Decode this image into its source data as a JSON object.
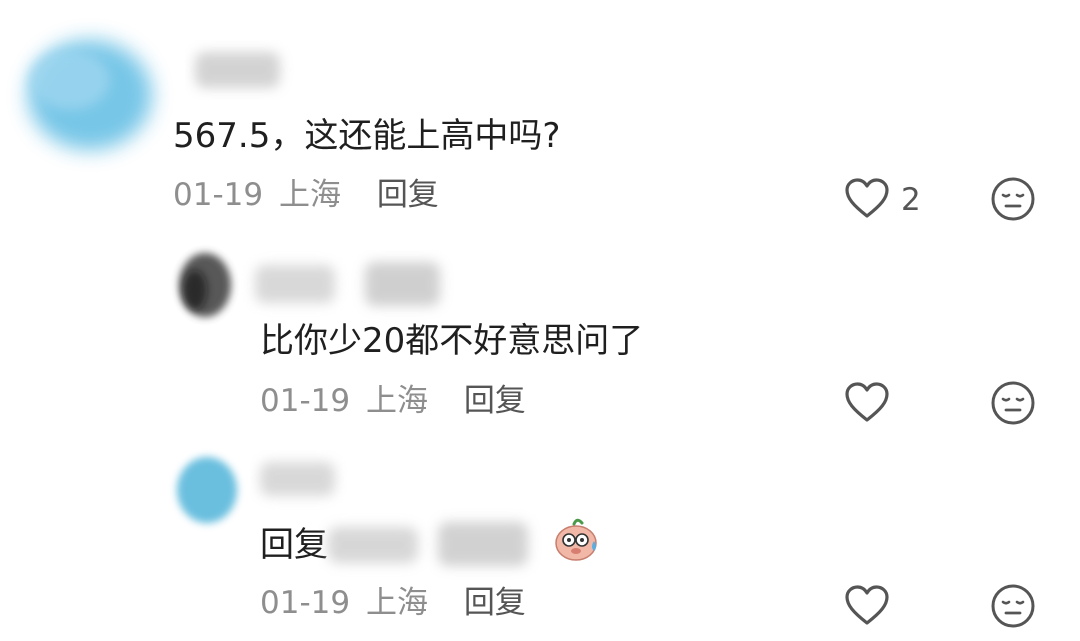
{
  "comments": [
    {
      "text": "567.5，这还能上高中吗?",
      "date": "01-19",
      "location": "上海",
      "reply_label": "回复",
      "like_count": "2",
      "avatar_color": "#6fc3e6"
    },
    {
      "text": "比你少20都不好意思问了",
      "date": "01-19",
      "location": "上海",
      "reply_label": "回复",
      "like_count": "",
      "avatar_color": "#333333"
    },
    {
      "text": "回复",
      "date": "01-19",
      "location": "上海",
      "reply_label": "回复",
      "like_count": "",
      "avatar_color": "#5ab8db"
    }
  ],
  "icons": {
    "like": "heart-outline-icon",
    "dislike": "meh-face-icon",
    "emoji": "piggy-sweat-emoji"
  }
}
